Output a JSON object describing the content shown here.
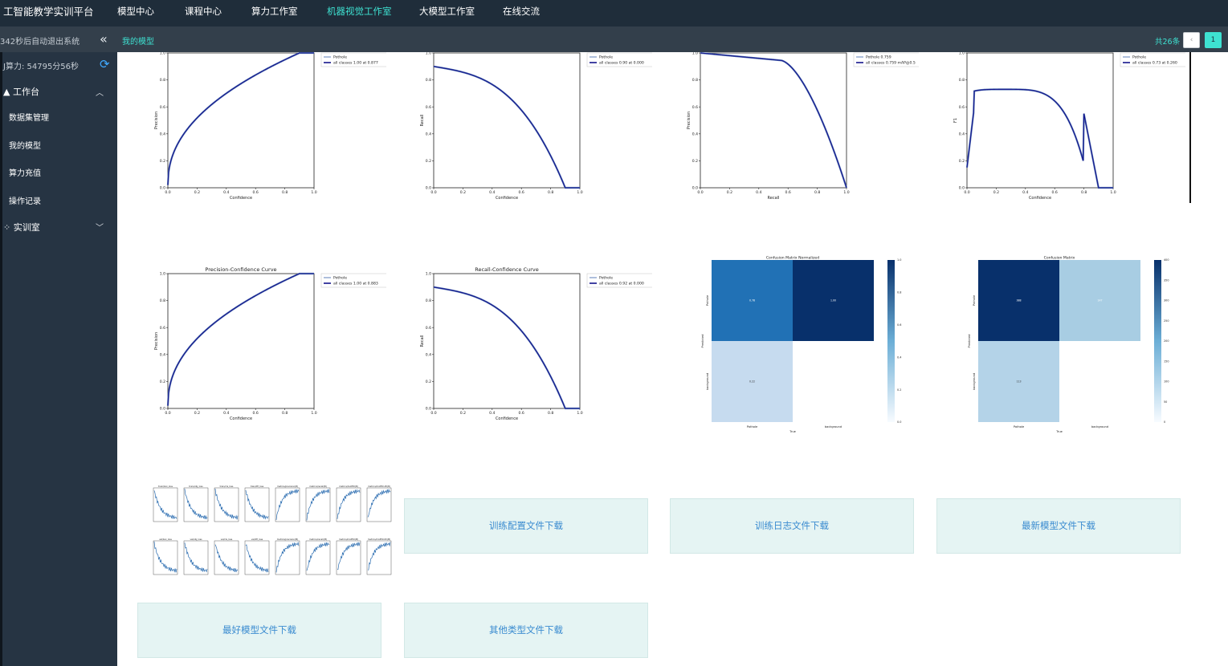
{
  "app": {
    "title": "工智能教学实训平台",
    "nav": [
      {
        "label": "模型中心",
        "active": false
      },
      {
        "label": "课程中心",
        "active": false
      },
      {
        "label": "算力工作室",
        "active": false
      },
      {
        "label": "机器视觉工作室",
        "active": true
      },
      {
        "label": "大模型工作室",
        "active": false
      },
      {
        "label": "在线交流",
        "active": false
      }
    ]
  },
  "subbar": {
    "timer": "342秒后自动退出系统",
    "collapse_icon": "«",
    "breadcrumb": "我的模型",
    "total": "共26条",
    "prev_icon": "‹",
    "current_page": "1"
  },
  "sidebar": {
    "credit": "J算力: 54795分56秒",
    "refresh_icon": "⟳",
    "workbench": {
      "label": "工作台",
      "icon": "person-icon",
      "caret": "︿"
    },
    "items": [
      {
        "label": "数据集管理"
      },
      {
        "label": "我的模型"
      },
      {
        "label": "算力充值"
      },
      {
        "label": "操作记录"
      }
    ],
    "lab": {
      "label": "实训室",
      "icon": "grid-icon",
      "caret": "﹀"
    }
  },
  "plots": {
    "p1": {
      "ylabel": "Precision",
      "xlabel": "Confidence",
      "legend": [
        "Pothole",
        "all classes 1.00 at 0.877"
      ]
    },
    "p2": {
      "ylabel": "Recall",
      "xlabel": "Confidence",
      "legend": [
        "Pothole",
        "all classes 0.90 at 0.000"
      ]
    },
    "p3": {
      "ylabel": "Precision",
      "xlabel": "Recall",
      "legend": [
        "Pothole 0.759",
        "all classes 0.759 mAP@0.5"
      ]
    },
    "p4": {
      "ylabel": "F1",
      "xlabel": "Confidence",
      "legend": [
        "Pothole",
        "all classes 0.73 at 0.260"
      ]
    },
    "p5": {
      "title": "Precision-Confidence Curve",
      "ylabel": "Precision",
      "xlabel": "Confidence",
      "legend": [
        "Pothole",
        "all classes 1.00 at 0.883"
      ]
    },
    "p6": {
      "title": "Recall-Confidence Curve",
      "ylabel": "Recall",
      "xlabel": "Confidence",
      "legend": [
        "Pothole",
        "all classes 0.92 at 0.000"
      ]
    },
    "cm1": {
      "title": "Confusion Matrix Normalized",
      "cells": [
        "0.78",
        "1.00",
        "0.22"
      ],
      "xlabels": [
        "Pothole",
        "background"
      ],
      "ylabels": [
        "Pothole",
        "background"
      ],
      "xlabel": "True",
      "ylabel": "Predicted",
      "cbar": [
        "1.0",
        "0.8",
        "0.6",
        "0.4",
        "0.2",
        "0.0"
      ]
    },
    "cm2": {
      "title": "Confusion Matrix",
      "cells": [
        "388",
        "147",
        "113"
      ],
      "xlabels": [
        "Pothole",
        "background"
      ],
      "ylabels": [
        "Pothole",
        "background"
      ],
      "xlabel": "True",
      "ylabel": "Predicted",
      "cbar": [
        "400",
        "350",
        "300",
        "250",
        "200",
        "150",
        "100",
        "50",
        "0"
      ]
    }
  },
  "ticks_unit": [
    "0.0",
    "0.2",
    "0.4",
    "0.6",
    "0.8",
    "1.0"
  ],
  "results_panels": [
    "train/box_loss",
    "train/obj_loss",
    "train/cls_loss",
    "train/dfl_loss",
    "metrics/precision(B)",
    "metrics/recall(B)",
    "metrics/mAP50(B)",
    "metrics/mAP50-95(B)",
    "val/box_loss",
    "val/obj_loss",
    "val/cls_loss",
    "val/dfl_loss",
    "metrics/precision(M)",
    "metrics/recall(M)",
    "metrics/mAP50(M)",
    "metrics/mAP50-95(M)"
  ],
  "downloads": [
    {
      "label": "训练配置文件下载"
    },
    {
      "label": "训练日志文件下载"
    },
    {
      "label": "最新模型文件下载"
    },
    {
      "label": "最好模型文件下载"
    },
    {
      "label": "其他类型文件下载"
    }
  ],
  "colors": {
    "accent": "#3ee1d1",
    "topbar": "#1f2d3a",
    "sidebar": "#263443",
    "curve": "#14148c",
    "cm_dark": "#08306b",
    "cm_mid": "#2171b5",
    "cm_light": "#c6dbef"
  }
}
